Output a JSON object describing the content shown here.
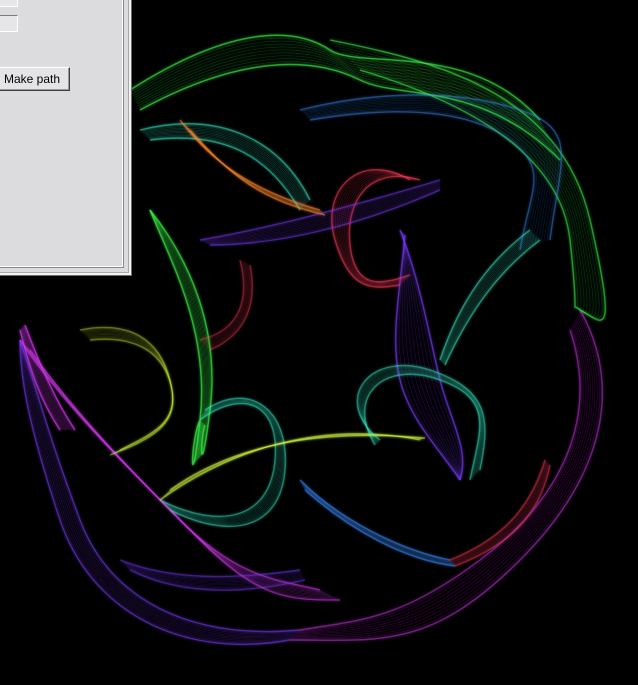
{
  "panel": {
    "make_path_label": "Make path",
    "field_a_value": "",
    "field_b_value": ""
  },
  "artwork": {
    "background": "#000000",
    "palette": [
      "#3cff4a",
      "#7a3cff",
      "#e23cff",
      "#3c8cff",
      "#ff8a2c",
      "#ff3c5a",
      "#3cffd6",
      "#d4ff3c"
    ]
  }
}
